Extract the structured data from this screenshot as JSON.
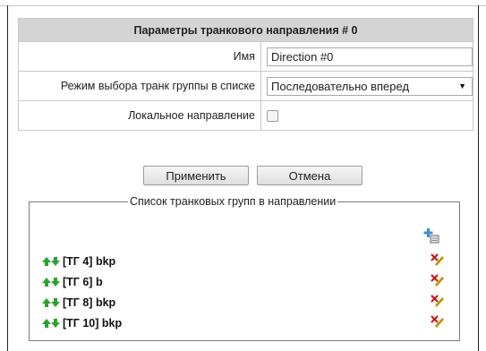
{
  "panel": {
    "title": "Параметры транкового направления # 0",
    "name_label": "Имя",
    "name_value": "Direction #0",
    "mode_label": "Режим выбора транк группы в списке",
    "mode_value": "Последовательно вперед",
    "local_label": "Локальное направление",
    "local_checked": false
  },
  "buttons": {
    "apply": "Применить",
    "cancel": "Отмена"
  },
  "groups": {
    "legend": "Список транковых групп в направлении",
    "items": [
      {
        "label": "[ТГ 4] bkp"
      },
      {
        "label": "[ТГ 6] b"
      },
      {
        "label": "[ТГ 8] bkp"
      },
      {
        "label": "[ТГ 10] bkp"
      }
    ]
  },
  "colors": {
    "header_bg": "#d4d4d4",
    "arrow_green": "#2fa02f",
    "delete_red": "#d01010",
    "edit_yellow": "#e0b020",
    "add_blue": "#3a8fd8"
  },
  "icons": {
    "move_up": "arrow-up-icon",
    "move_down": "arrow-down-icon",
    "delete_edit": "delete-edit-icon",
    "add": "add-icon"
  }
}
